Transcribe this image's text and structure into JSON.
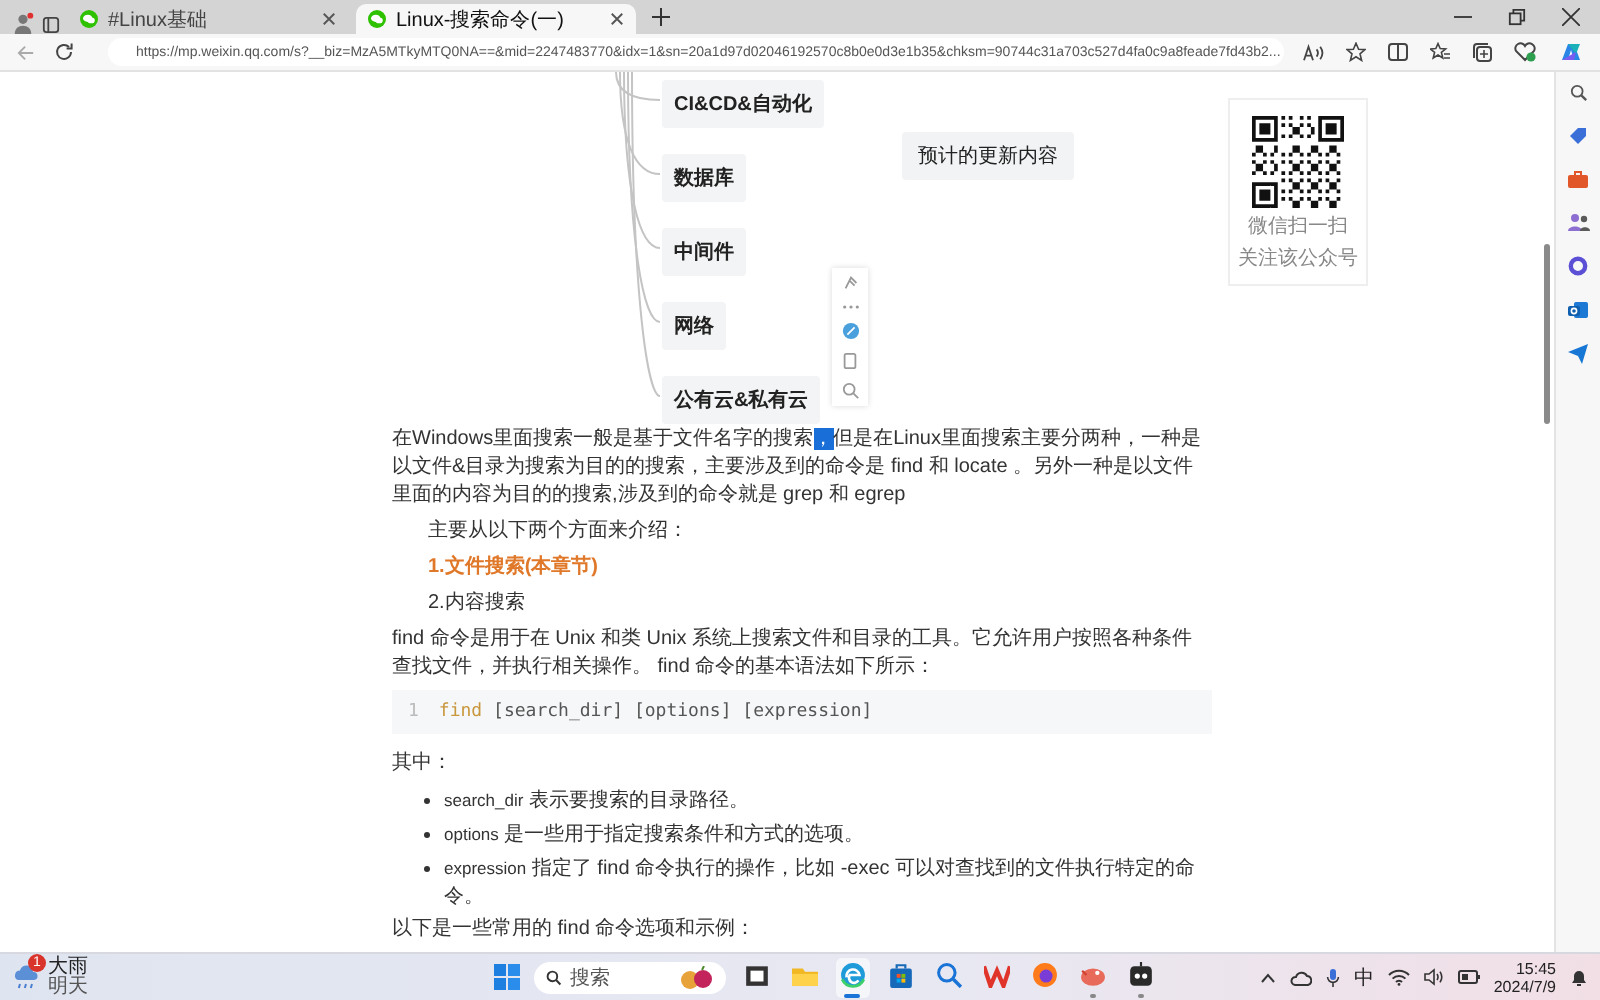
{
  "browser": {
    "tabs": [
      {
        "title": "#Linux基础",
        "selected": false
      },
      {
        "title": "Linux-搜索命令(一)",
        "selected": true
      }
    ],
    "url": "https://mp.weixin.qq.com/s?__biz=MzA5MTkyMTQ0NA==&mid=2247483770&idx=1&sn=20a1d97d02046192570c8b0e0d3e1b35&chksm=90744c31a703c527d4fa0c9a8feade7fd43b2..."
  },
  "mindmap": {
    "branches": [
      "CI&CD&自动化",
      "数据库",
      "中间件",
      "网络",
      "公有云&私有云"
    ],
    "side_node": "预计的更新内容"
  },
  "qr_card": {
    "lines": [
      "微信扫一扫",
      "关注该公众号"
    ]
  },
  "article": {
    "intro": {
      "before": "在Windows里面搜索一般是基于文件名字的搜索",
      "selected_text": "，",
      "after": "但是在Linux里面搜索主要分两种，一种是以文件&目录为搜索为目的的搜索，主要涉及到的命令是 find 和 locate 。另外一种是以文件里面的内容为目的的搜索,涉及到的命令就是 grep 和 egrep"
    },
    "lead": "主要从以下两个方面来介绍：",
    "sections": [
      {
        "text": "1.文件搜索(本章节)",
        "highlighted": true
      },
      {
        "text": "2.内容搜索",
        "highlighted": false
      }
    ],
    "find_intro": "find 命令是用于在 Unix 和类 Unix 系统上搜索文件和目录的工具。它允许用户按照各种条件查找文件，并执行相关操作。 find 命令的基本语法如下所示：",
    "code": {
      "line_number": "1",
      "keyword": "find",
      "args": " [search_dir] [options] [expression]"
    },
    "list_title": "其中：",
    "bullets": [
      {
        "term": "search_dir",
        "text": " 表示要搜索的目录路径。"
      },
      {
        "term": "options",
        "text": " 是一些用于指定搜索条件和方式的选项。"
      },
      {
        "term": "expression",
        "text": " 指定了 find 命令执行的操作，比如 -exec 可以对查找到的文件执行特定的命令。"
      }
    ],
    "outro": "以下是一些常用的 find 命令选项和示例："
  },
  "taskbar": {
    "weather": {
      "badge": "1",
      "condition": "大雨",
      "day": "明天"
    },
    "search": {
      "placeholder": "搜索"
    },
    "apps": [
      {
        "kind": "taskview",
        "running": false,
        "selected": false
      },
      {
        "kind": "explorer",
        "running": false,
        "selected": false
      },
      {
        "kind": "edge",
        "running": true,
        "selected": true
      },
      {
        "kind": "store",
        "running": false,
        "selected": false
      },
      {
        "kind": "search",
        "running": false,
        "selected": false
      },
      {
        "kind": "wps",
        "running": false,
        "selected": false
      },
      {
        "kind": "firefox",
        "running": false,
        "selected": false
      },
      {
        "kind": "bird",
        "running": true,
        "selected": false
      },
      {
        "kind": "robot",
        "running": true,
        "selected": false
      }
    ],
    "ime": "中",
    "clock": {
      "time": "15:45",
      "date": "2024/7/9"
    }
  }
}
